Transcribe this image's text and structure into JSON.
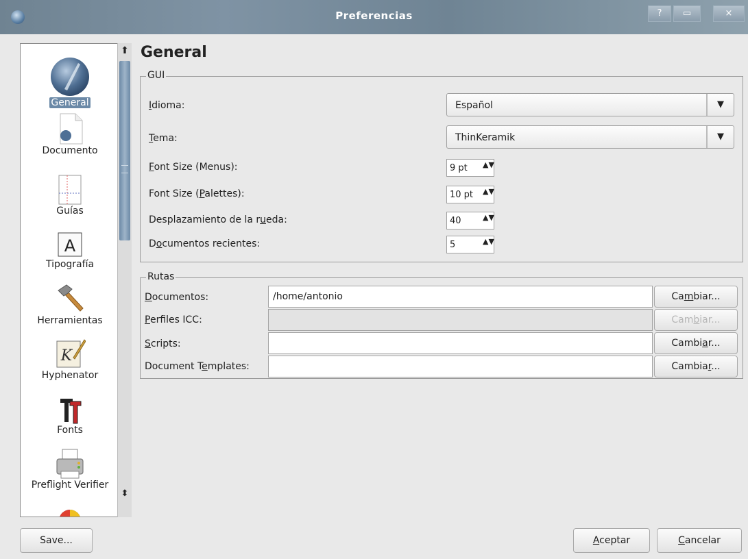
{
  "window": {
    "title": "Preferencias",
    "help_glyph": "?",
    "max_glyph": "▭",
    "close_glyph": "×"
  },
  "sidebar": {
    "items": [
      {
        "label": "General",
        "icon": "general-icon",
        "selected": true
      },
      {
        "label": "Documento",
        "icon": "document-icon"
      },
      {
        "label": "Guías",
        "icon": "guides-icon"
      },
      {
        "label": "Tipografía",
        "icon": "typography-icon"
      },
      {
        "label": "Herramientas",
        "icon": "hammer-icon"
      },
      {
        "label": "Hyphenator",
        "icon": "hyphenator-icon"
      },
      {
        "label": "Fonts",
        "icon": "fonts-icon"
      },
      {
        "label": "Preflight Verifier",
        "icon": "printer-icon"
      }
    ],
    "scroll_up": "⬆",
    "scroll_down": "⬍"
  },
  "page": {
    "title": "General"
  },
  "gui": {
    "legend": "GUI",
    "idioma": {
      "label_u": "I",
      "label_rest": "dioma:",
      "value": "Español"
    },
    "tema": {
      "label_u": "T",
      "label_rest": "ema:",
      "value": "ThinKeramik"
    },
    "font_menus": {
      "label_u": "F",
      "label_rest": "ont Size (Menus):",
      "value": "9 pt"
    },
    "font_palettes": {
      "label_pre": "Font Size (",
      "label_u": "P",
      "label_rest": "alettes):",
      "value": "10 pt"
    },
    "wheel": {
      "label_pre": "Desplazamiento de la r",
      "label_u": "u",
      "label_rest": "eda:",
      "value": "40"
    },
    "recent": {
      "label_pre": "D",
      "label_u": "o",
      "label_rest": "cumentos recientes:",
      "value": "5"
    },
    "combo_arrow": "▼",
    "spin_glyph": "▲▼"
  },
  "rutas": {
    "legend": "Rutas",
    "rows": [
      {
        "label_u": "D",
        "label_rest": "ocumentos:",
        "value": "/home/antonio",
        "btn_pre": "Ca",
        "btn_u": "m",
        "btn_rest": "biar...",
        "enabled": true
      },
      {
        "label_u": "P",
        "label_rest": "erfiles ICC:",
        "value": "",
        "btn_pre": "Cam",
        "btn_u": "b",
        "btn_rest": "iar...",
        "enabled": false
      },
      {
        "label_u": "S",
        "label_rest": "cripts:",
        "value": "",
        "btn_pre": "Cambi",
        "btn_u": "a",
        "btn_rest": "r...",
        "enabled": true
      },
      {
        "label_pre": "Document T",
        "label_u": "e",
        "label_rest": "mplates:",
        "value": "",
        "btn_pre": "Cambia",
        "btn_u": "r",
        "btn_rest": "...",
        "enabled": true
      }
    ]
  },
  "buttons": {
    "save": "Save...",
    "accept_u": "A",
    "accept_rest": "ceptar",
    "cancel_u": "C",
    "cancel_rest": "ancelar"
  }
}
